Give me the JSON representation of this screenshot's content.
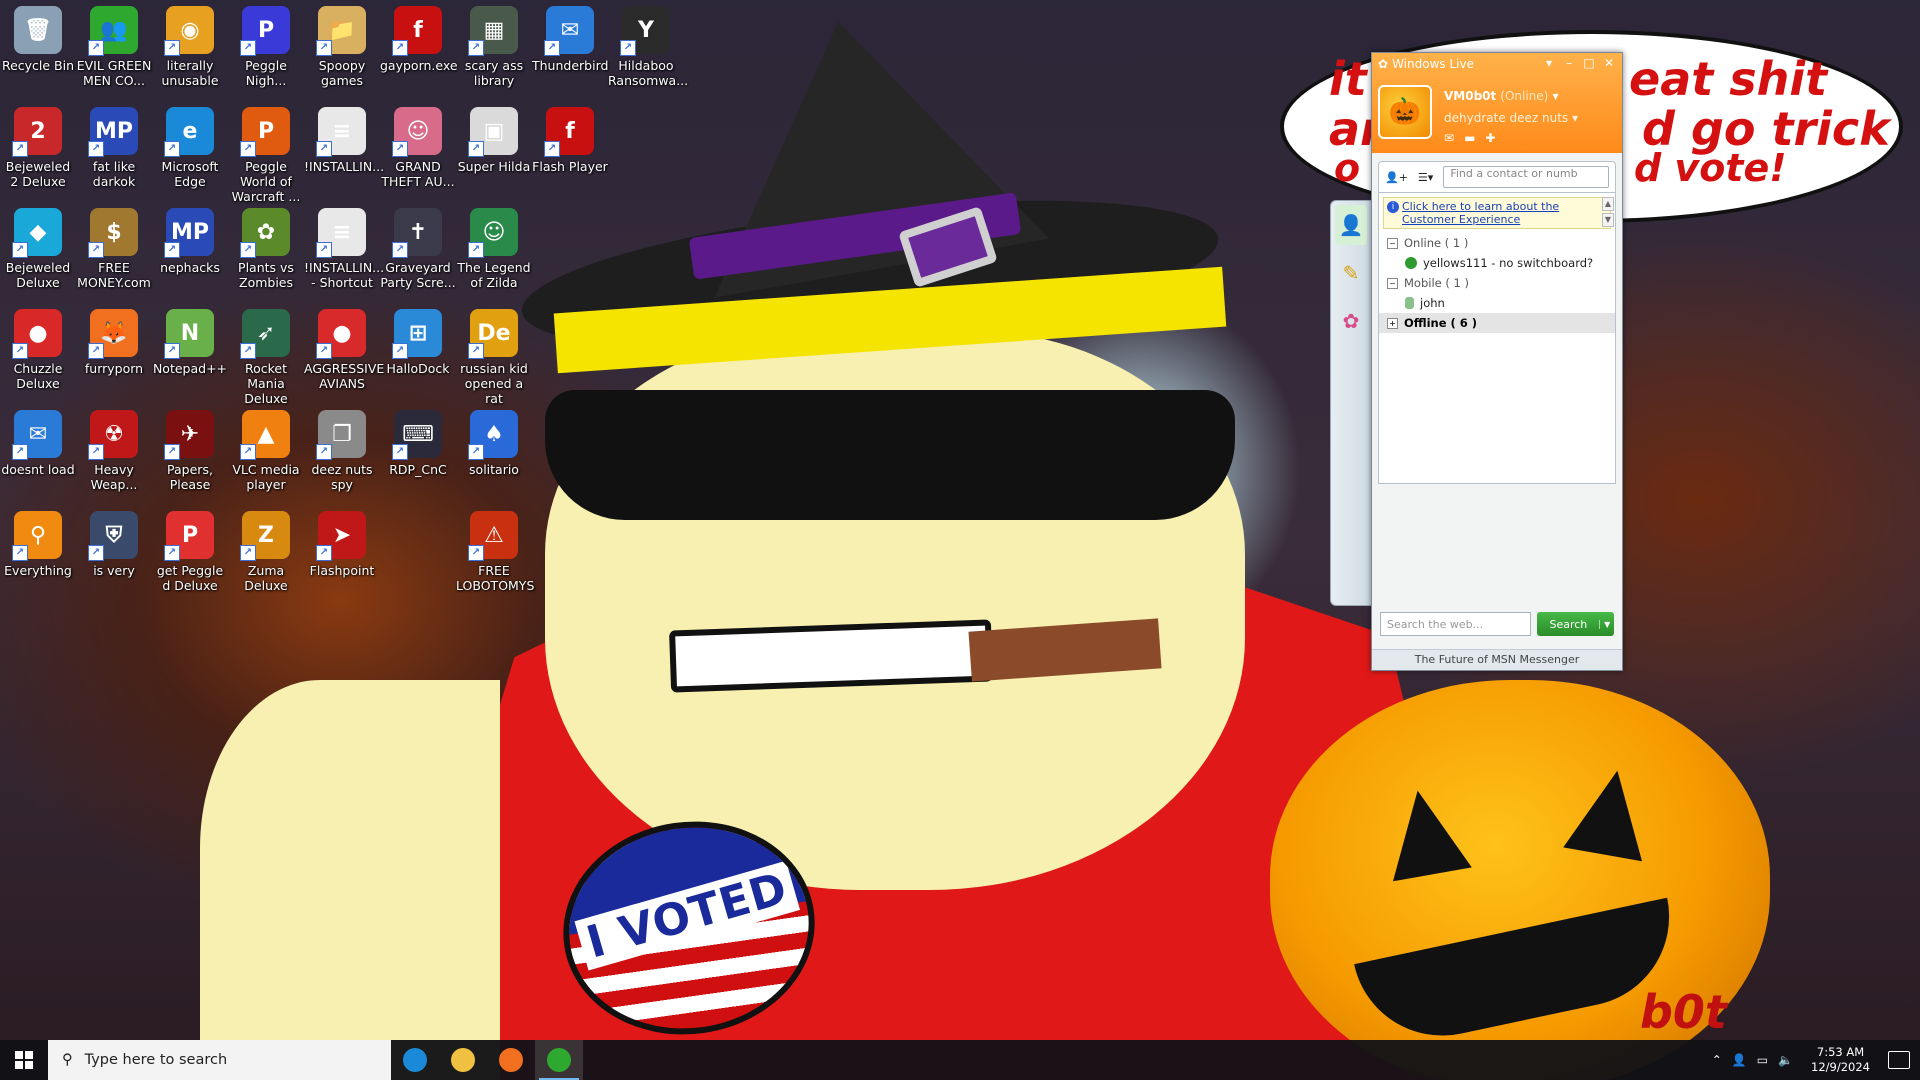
{
  "desktop": {
    "icons": [
      {
        "label": "Recycle Bin",
        "icon": "recycle-bin-icon",
        "color": "#8aa0b4",
        "glyph": "🗑"
      },
      {
        "label": "Bejeweled 2 Deluxe",
        "icon": "bejeweled-2-icon",
        "color": "#c8282a",
        "glyph": "2"
      },
      {
        "label": "Bejeweled Deluxe",
        "icon": "bejeweled-icon",
        "color": "#1aa8d8",
        "glyph": "◆"
      },
      {
        "label": "Chuzzle Deluxe",
        "icon": "chuzzle-icon",
        "color": "#d82828",
        "glyph": "●"
      },
      {
        "label": "doesnt load",
        "icon": "thunderbird-icon",
        "color": "#2a7ad8",
        "glyph": "✉"
      },
      {
        "label": "Everything",
        "icon": "magnifier-icon",
        "color": "#f08a10",
        "glyph": "⚲"
      },
      {
        "label": "EVIL GREEN MEN CO...",
        "icon": "msn-people-icon",
        "color": "#2fa82f",
        "glyph": "👥"
      },
      {
        "label": "fat like darkok",
        "icon": "mpl-icon",
        "color": "#2a4ab8",
        "glyph": "MP"
      },
      {
        "label": "FREE MONEY.com",
        "icon": "money-bag-icon",
        "color": "#a07830",
        "glyph": "$"
      },
      {
        "label": "furryporn",
        "icon": "firefox-icon",
        "color": "#f07020",
        "glyph": "🦊"
      },
      {
        "label": "Heavy Weap...",
        "icon": "radiation-icon",
        "color": "#c01818",
        "glyph": "☢"
      },
      {
        "label": "is very",
        "icon": "shield-logo-icon",
        "color": "#3a4a6a",
        "glyph": "⛨"
      },
      {
        "label": "literally unusable",
        "icon": "chrome-icon",
        "color": "#e8a020",
        "glyph": "◉"
      },
      {
        "label": "Microsoft Edge",
        "icon": "edge-icon",
        "color": "#1a8ad8",
        "glyph": "e"
      },
      {
        "label": "nephacks",
        "icon": "mpl-icon",
        "color": "#2a4ab8",
        "glyph": "MP"
      },
      {
        "label": "Notepad++",
        "icon": "notepad-plus-icon",
        "color": "#6ab04a",
        "glyph": "N"
      },
      {
        "label": "Papers, Please",
        "icon": "papers-please-icon",
        "color": "#7a1010",
        "glyph": "✈"
      },
      {
        "label": "get Peggle d Deluxe",
        "icon": "peggle-icon",
        "color": "#e03030",
        "glyph": "P"
      },
      {
        "label": "Peggle Nigh...",
        "icon": "peggle-nights-icon",
        "color": "#3a3ad8",
        "glyph": "P"
      },
      {
        "label": "Peggle World of Warcraft ...",
        "icon": "peggle-wow-icon",
        "color": "#e05a10",
        "glyph": "P"
      },
      {
        "label": "Plants vs Zombies",
        "icon": "pvz-icon",
        "color": "#5a8a2a",
        "glyph": "✿"
      },
      {
        "label": "Rocket Mania Deluxe",
        "icon": "rocket-mania-icon",
        "color": "#2a6a4a",
        "glyph": "➶"
      },
      {
        "label": "VLC media player",
        "icon": "vlc-icon",
        "color": "#f08010",
        "glyph": "▲"
      },
      {
        "label": "Zuma Deluxe",
        "icon": "zuma-icon",
        "color": "#d88a10",
        "glyph": "Z"
      },
      {
        "label": "Spoopy games",
        "icon": "folder-icon",
        "color": "#d8b060",
        "glyph": "📁"
      },
      {
        "label": "!INSTALLIN...",
        "icon": "document-icon",
        "color": "#e8e8e8",
        "glyph": "≡"
      },
      {
        "label": "!INSTALLIN... - Shortcut",
        "icon": "document-icon",
        "color": "#e8e8e8",
        "glyph": "≡"
      },
      {
        "label": "AGGRESSIVE AVIANS",
        "icon": "angry-birds-icon",
        "color": "#d82a2a",
        "glyph": "●"
      },
      {
        "label": "deez nuts spy",
        "icon": "windows-stack-icon",
        "color": "#8a8a8a",
        "glyph": "❐"
      },
      {
        "label": "Flashpoint",
        "icon": "flashpoint-icon",
        "color": "#c01818",
        "glyph": "➤"
      },
      {
        "label": "gayporn.exe",
        "icon": "flash-icon",
        "color": "#c81010",
        "glyph": "f"
      },
      {
        "label": "GRAND THEFT AU...",
        "icon": "anime-girl-icon",
        "color": "#d86a8a",
        "glyph": "☺"
      },
      {
        "label": "Graveyard Party Scre...",
        "icon": "graveyard-icon",
        "color": "#3a3a4a",
        "glyph": "✝"
      },
      {
        "label": "HalloDock",
        "icon": "windows-logo-icon",
        "color": "#2a8ad8",
        "glyph": "⊞"
      },
      {
        "label": "RDP_CnC",
        "icon": "rdp-icon",
        "color": "#2a2a3a",
        "glyph": "⌨"
      },
      {
        "label": "scary ass library",
        "icon": "library-icon",
        "color": "#4a5a4a",
        "glyph": "▦"
      },
      {
        "label": "Super Hilda",
        "icon": "pixel-hilda-icon",
        "color": "#dadada",
        "glyph": "▣"
      },
      {
        "label": "The Legend of Zilda",
        "icon": "zilda-icon",
        "color": "#2a8a4a",
        "glyph": "☺"
      },
      {
        "label": "russian kid opened a rat",
        "icon": "de-icon",
        "color": "#e0a010",
        "glyph": "De"
      },
      {
        "label": "solitario",
        "icon": "solitaire-icon",
        "color": "#2a6ad8",
        "glyph": "♠"
      },
      {
        "label": "FREE LOBOTOMYS",
        "icon": "lobotomy-icon",
        "color": "#c83010",
        "glyph": "⚠"
      },
      {
        "label": "Thunderbird",
        "icon": "thunderbird-icon",
        "color": "#2a7ad8",
        "glyph": "✉"
      },
      {
        "label": "Flash Player",
        "icon": "flash-icon",
        "color": "#c81010",
        "glyph": "f"
      },
      {
        "label": "Hildaboo Ransomwa...",
        "icon": "yashma-icon",
        "color": "#2a2a2a",
        "glyph": "Y"
      }
    ]
  },
  "wallpaper": {
    "speech_bubble": [
      "it",
      "eat shit",
      "ar",
      "d go trick",
      "o",
      "d vote!"
    ],
    "sticker_text": "I VOTED",
    "watermark": "b0t"
  },
  "msn": {
    "title": "Windows Live",
    "user_name": "VM0b0t",
    "user_status": "(Online)",
    "personal_message": "dehydrate deez nuts",
    "find_placeholder": "Find a contact or numb",
    "info_link": "Click here to learn about the Customer Experience",
    "groups": [
      {
        "label": "Online ( 1 )",
        "expanded": true,
        "contacts": [
          "yellows111 - no switchboard?"
        ]
      },
      {
        "label": "Mobile ( 1 )",
        "expanded": true,
        "contacts": [
          "john"
        ]
      },
      {
        "label": "Offline ( 6 )",
        "expanded": false,
        "contacts": []
      }
    ],
    "web_search_placeholder": "Search the web...",
    "search_button": "Search",
    "footer": "The Future of MSN Messenger",
    "accent": "#ff8a1a"
  },
  "taskbar": {
    "search_placeholder": "Type here to search",
    "apps": [
      {
        "name": "edge-icon",
        "color": "#1a8ad8",
        "active": false
      },
      {
        "name": "file-explorer-icon",
        "color": "#f0c040",
        "active": false
      },
      {
        "name": "firefox-icon",
        "color": "#f07020",
        "active": false
      },
      {
        "name": "msn-messenger-icon",
        "color": "#2fa82f",
        "active": true
      }
    ],
    "time": "7:53 AM",
    "date": "12/9/2024"
  }
}
